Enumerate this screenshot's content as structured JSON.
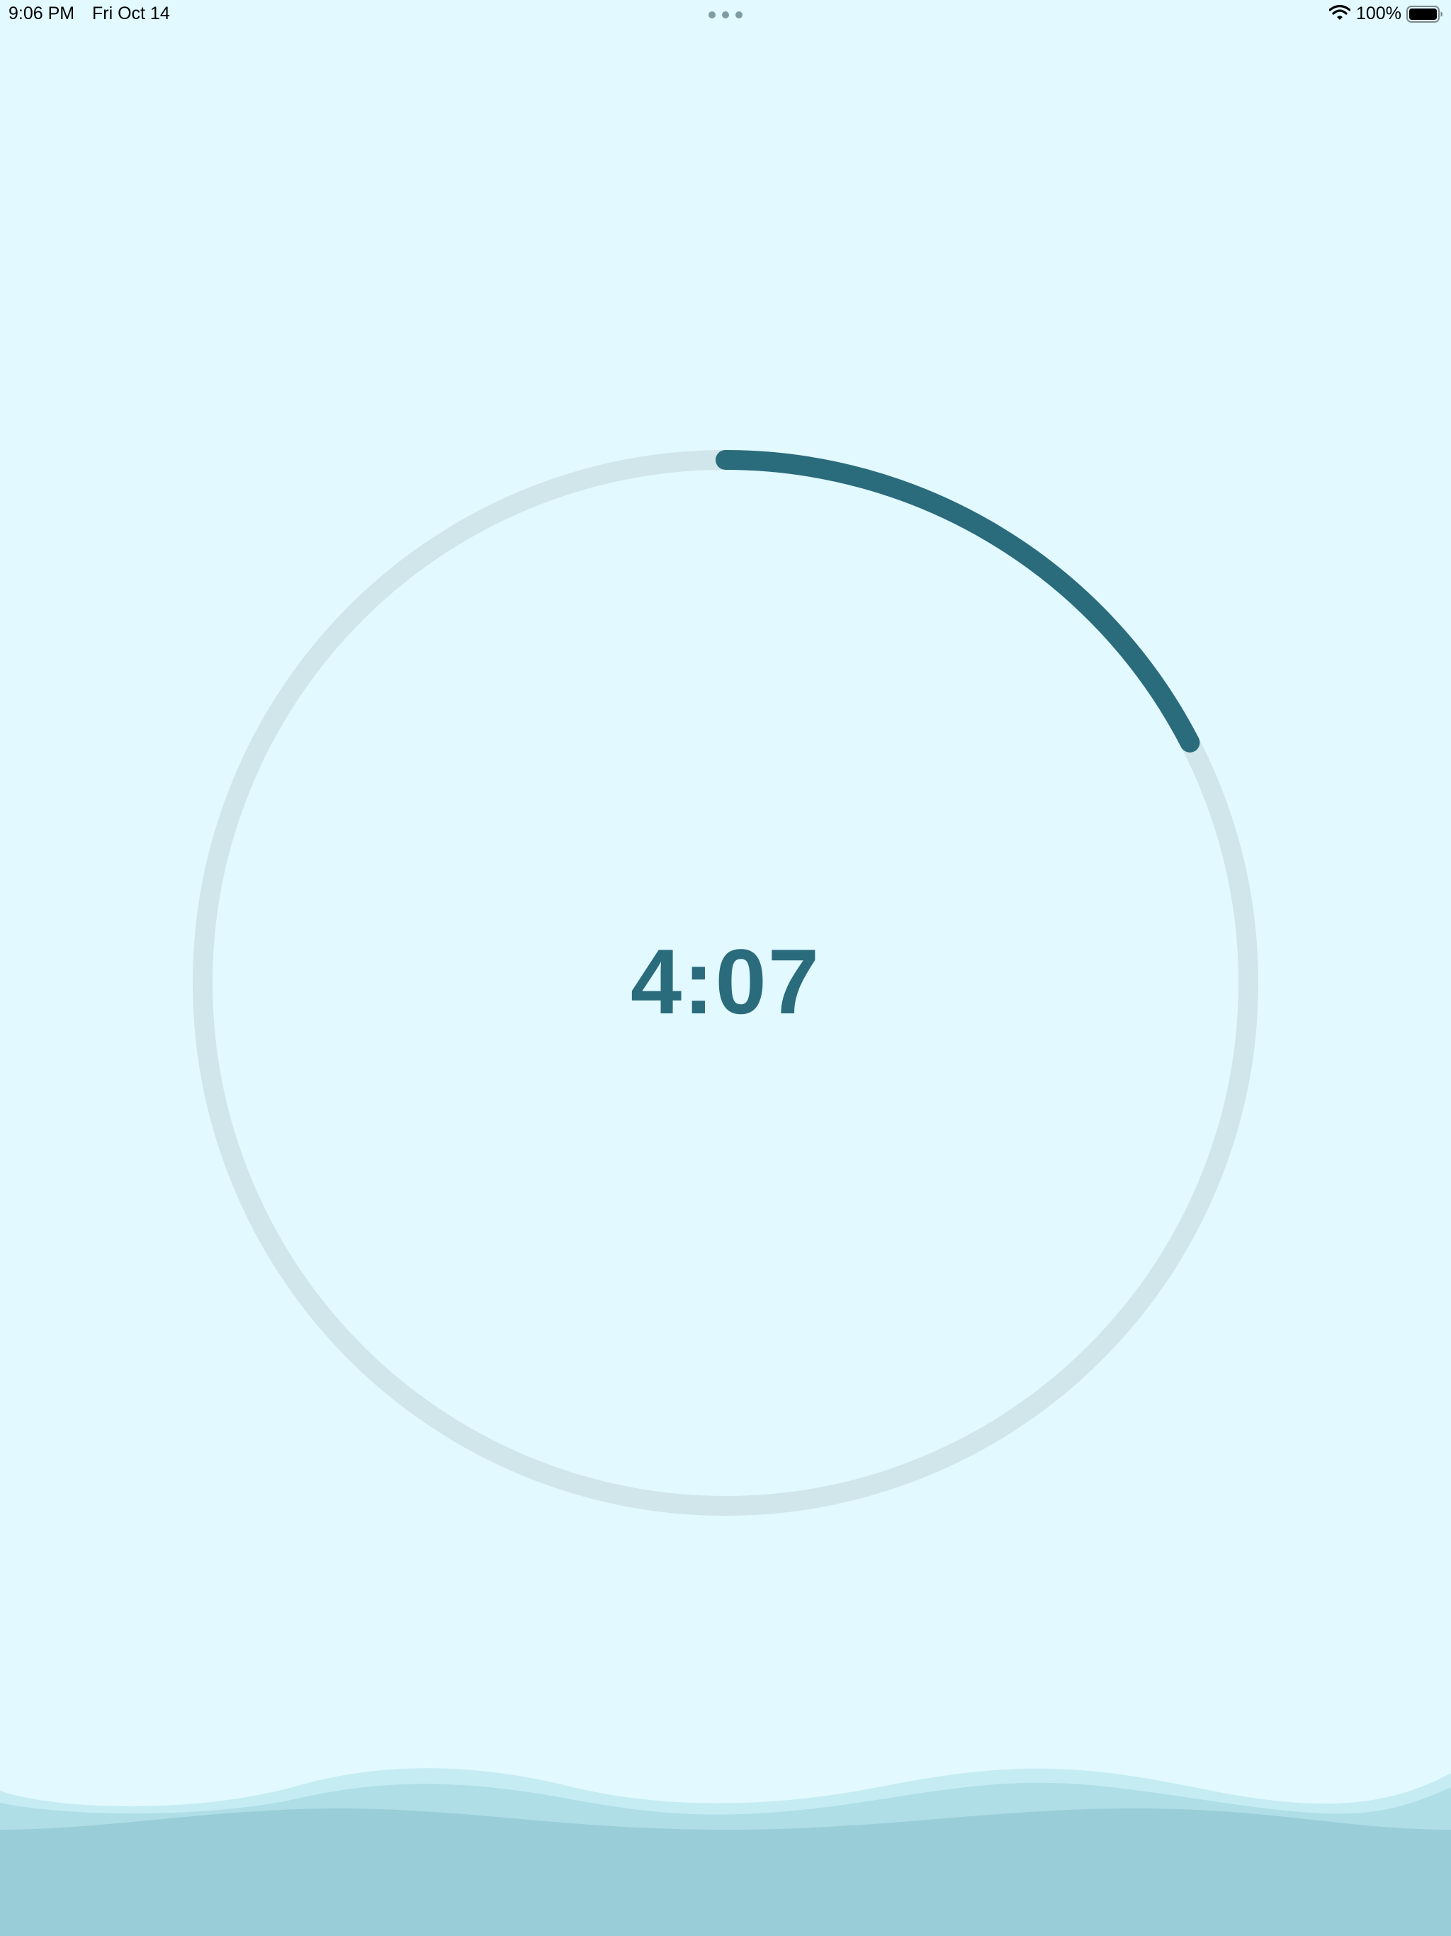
{
  "status_bar": {
    "time": "9:06 PM",
    "date": "Fri Oct 14",
    "battery_percent": "100%",
    "wifi_icon": "wifi-icon",
    "battery_icon": "battery-icon",
    "multitask_icon": "multitask-dots-icon"
  },
  "timer": {
    "display": "4:07",
    "progress_fraction": 0.174
  },
  "colors": {
    "background": "#e1f9ff",
    "accent": "#2a6b7c",
    "track": "#d1e6ea",
    "wave_light": "#c5ecf3",
    "wave_mid": "#afdee7",
    "wave_dark": "#99ced9"
  }
}
